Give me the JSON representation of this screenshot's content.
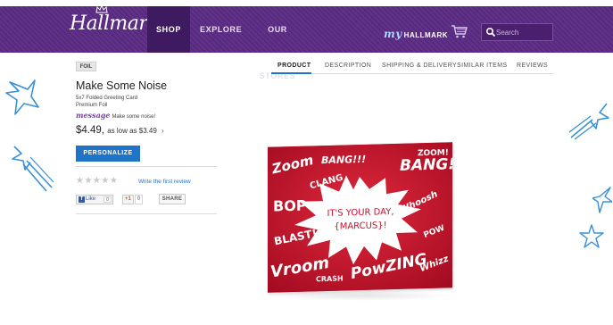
{
  "header": {
    "logo_text": "Hallmark",
    "nav": {
      "shop": "SHOP",
      "explore": "EXPLORE",
      "stores": "OUR STORES"
    },
    "my_hallmark": {
      "my": "my",
      "label": "HALLMARK"
    },
    "search_placeholder": "Search"
  },
  "product": {
    "badge": "FOIL",
    "title": "Make Some Noise",
    "subtitle_line1": "5x7 Folded Greeting Card",
    "subtitle_line2": "Premium Foil",
    "message_word": "message",
    "message_text": "Make some noise!",
    "price": "$4.49,",
    "as_low_as": "as low as $3.49",
    "chevron": "›",
    "personalize_label": "PERSONALIZE",
    "stars": "★★★★★",
    "rating_value": 0,
    "review_link": "Write the first review",
    "like_label": "Like",
    "like_count": "0",
    "gplus_label": "+1",
    "gplus_count": "0",
    "share_label": "SHARE"
  },
  "tabs": [
    {
      "label": "PRODUCT",
      "active": true
    },
    {
      "label": "DESCRIPTION",
      "active": false
    },
    {
      "label": "SHIPPING & DELIVERY",
      "active": false
    },
    {
      "label": "SIMILAR ITEMS",
      "active": false
    },
    {
      "label": "REVIEWS",
      "active": false
    }
  ],
  "card": {
    "words": {
      "zoom_left": "Zoom",
      "bang_top": "BANG!!!",
      "bang_right": "BANG!",
      "zoom_right": "ZOOM!",
      "clang": "CLANG",
      "bop": "BOP",
      "whoosh": "Whoosh",
      "blast": "BLAST!",
      "pow_right": "POW",
      "vroom": "Vroom",
      "crash": "CRASH",
      "powzing": "PowZING",
      "whizz": "Whizz"
    },
    "center_line1": "IT'S YOUR DAY,",
    "center_line2": "{MARCUS}!",
    "color_red": "#c8102e",
    "color_white": "#ffffff"
  },
  "colors": {
    "header_purple": "#5a2a83",
    "shop_tab": "#3e1a61",
    "accent_blue": "#1f74c8",
    "doodle_blue": "#3a8fd6"
  },
  "icons": [
    "crown-icon",
    "cart-icon",
    "search-icon",
    "facebook-icon",
    "star-icon",
    "doodle-star-icon",
    "shooting-star-icon"
  ]
}
